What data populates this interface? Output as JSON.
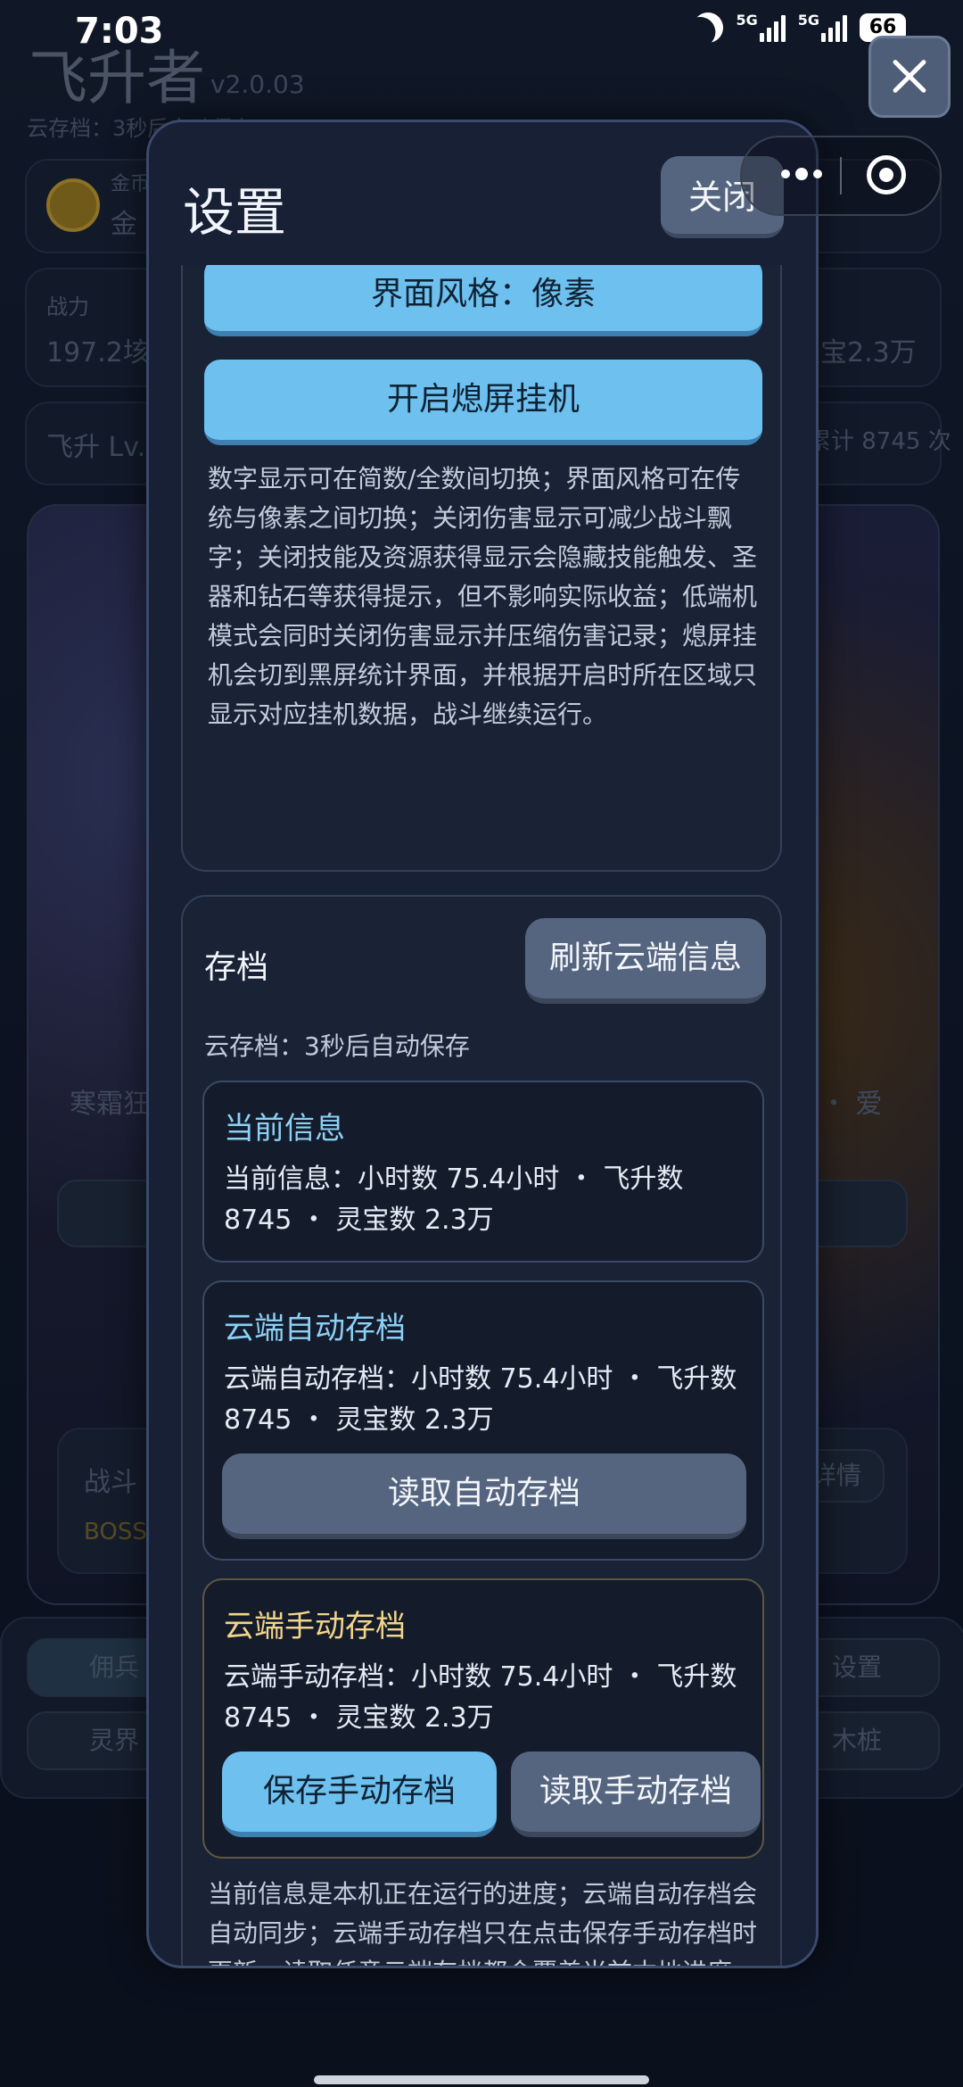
{
  "status_bar": {
    "time": "7:03",
    "net1": "5G",
    "net2": "5G",
    "battery": "66"
  },
  "background": {
    "app_title": "飞升者",
    "version": "v2.0.03",
    "autosave": "云存档：3秒后自动保存",
    "gold_label": "金币",
    "gold_value": "金",
    "power_label": "战力",
    "power_value": "197.2垓",
    "lingbao_value": "灵宝2.3万",
    "ascend_label": "飞升 Lv.",
    "ascend_count": "累计 8745 次",
    "frost_text": "寒霜狂",
    "love_text": "・ 爱",
    "battle_label": "战斗",
    "boss_label": "BOSS",
    "detail_btn": "详情",
    "tab_merc": "佣兵",
    "tab_settings": "设置",
    "tab_spirit": "灵界",
    "tab_dummy": "木桩"
  },
  "modal": {
    "title": "设置",
    "close_label": "关闭",
    "display_section": {
      "style_button": "界面风格：像素",
      "screen_off_button": "开启熄屏挂机",
      "description": "数字显示可在简数/全数间切换；界面风格可在传统与像素之间切换；关闭伤害显示可减少战斗飘字；关闭技能及资源获得显示会隐藏技能触发、圣器和钻石等获得提示，但不影响实际收益；低端机模式会同时关闭伤害显示并压缩伤害记录；熄屏挂机会切到黑屏统计界面，并根据开启时所在区域只显示对应挂机数据，战斗继续运行。"
    },
    "save_section": {
      "title": "存档",
      "refresh_button": "刷新云端信息",
      "autosave_note": "云存档：3秒后自动保存",
      "current": {
        "title": "当前信息",
        "text": "当前信息：小时数 75.4小时 ・ 飞升数 8745 ・ 灵宝数 2.3万"
      },
      "cloud_auto": {
        "title": "云端自动存档",
        "text": "云端自动存档：小时数 75.4小时 ・ 飞升数 8745 ・ 灵宝数 2.3万",
        "load_button": "读取自动存档"
      },
      "cloud_manual": {
        "title": "云端手动存档",
        "text": "云端手动存档：小时数 75.4小时 ・ 飞升数 8745 ・ 灵宝数 2.3万",
        "save_button": "保存手动存档",
        "load_button": "读取手动存档"
      },
      "footnote": "当前信息是本机正在运行的进度；云端自动存档会自动同步；云端手动存档只在点击保存手动存档时更新。读取任意云端存档都会覆盖当前本地进度，请先对比小时数、飞升数和灵宝数。"
    }
  },
  "colors": {
    "accent_blue": "#6ec0ef",
    "title_blue": "#8dd0f5",
    "title_gold": "#f2d58a",
    "slate_button": "#56657f",
    "modal_bg": "#172035"
  }
}
